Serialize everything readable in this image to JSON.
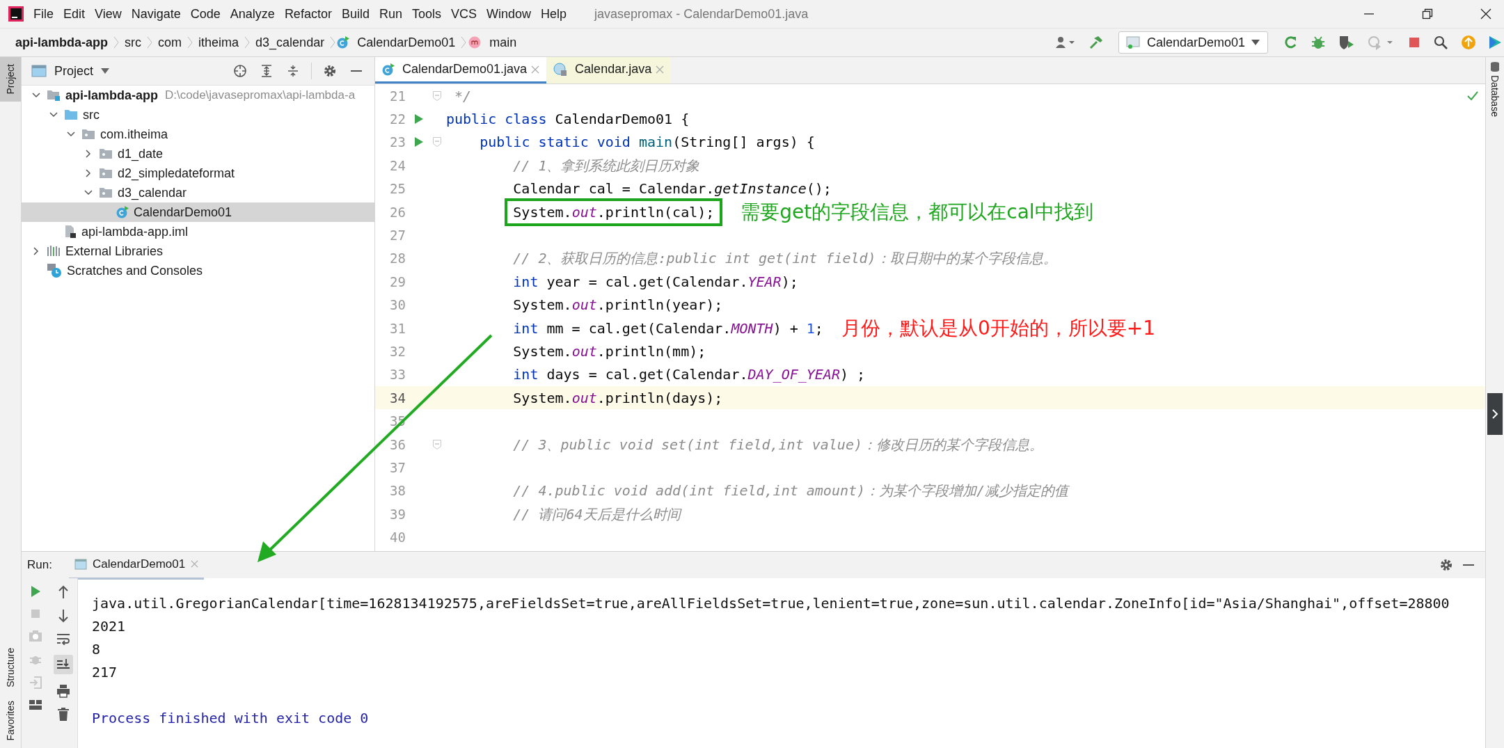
{
  "menu_bar": {
    "items": [
      "File",
      "Edit",
      "View",
      "Navigate",
      "Code",
      "Analyze",
      "Refactor",
      "Build",
      "Run",
      "Tools",
      "VCS",
      "Window",
      "Help"
    ],
    "window_title": "javasepromax - CalendarDemo01.java"
  },
  "breadcrumbs": [
    {
      "label": "api-lambda-app",
      "kind": "project"
    },
    {
      "label": "src",
      "kind": "folder"
    },
    {
      "label": "com",
      "kind": "folder"
    },
    {
      "label": "itheima",
      "kind": "folder"
    },
    {
      "label": "d3_calendar",
      "kind": "folder"
    },
    {
      "label": "CalendarDemo01",
      "kind": "class"
    },
    {
      "label": "main",
      "kind": "method"
    }
  ],
  "toolbar": {
    "run_config": "CalendarDemo01"
  },
  "side_strips": {
    "left_top": "Project",
    "left_bottom": [
      "Structure",
      "Favorites"
    ],
    "right": "Database"
  },
  "project_panel": {
    "title": "Project",
    "tree": [
      {
        "name": "api-lambda-app",
        "path": "D:\\code\\javasepromax\\api-lambda-a",
        "kind": "module",
        "expanded": true,
        "selected": false,
        "children": [
          {
            "name": "src",
            "kind": "source",
            "expanded": true,
            "selected": false,
            "children": [
              {
                "name": "com.itheima",
                "kind": "package",
                "expanded": true,
                "selected": false,
                "children": [
                  {
                    "name": "d1_date",
                    "kind": "package",
                    "expanded": false,
                    "selected": false
                  },
                  {
                    "name": "d2_simpledateformat",
                    "kind": "package",
                    "expanded": false,
                    "selected": false
                  },
                  {
                    "name": "d3_calendar",
                    "kind": "package",
                    "expanded": true,
                    "selected": false,
                    "children": [
                      {
                        "name": "CalendarDemo01",
                        "kind": "class",
                        "selected": true
                      }
                    ]
                  }
                ]
              }
            ]
          },
          {
            "name": "api-lambda-app.iml",
            "kind": "iml",
            "selected": false
          }
        ]
      },
      {
        "name": "External Libraries",
        "kind": "libraries",
        "expanded": false,
        "selected": false
      },
      {
        "name": "Scratches and Consoles",
        "kind": "scratches",
        "selected": false
      }
    ]
  },
  "editor": {
    "tabs": [
      {
        "title": "CalendarDemo01.java",
        "kind": "class",
        "selected": true
      },
      {
        "title": "Calendar.java",
        "kind": "library",
        "selected": false
      }
    ],
    "lines": [
      {
        "number": "21",
        "fold": true,
        "run_marker": false,
        "current": false,
        "boxed": false,
        "tokens": [
          {
            "text": " */",
            "kind": "comment"
          }
        ]
      },
      {
        "number": "22",
        "fold": false,
        "run_marker": true,
        "current": false,
        "boxed": false,
        "tokens": [
          {
            "text": "public class",
            "kind": "keyword"
          },
          {
            "text": " CalendarDemo01 {",
            "kind": "plain"
          }
        ]
      },
      {
        "number": "23",
        "fold": true,
        "run_marker": true,
        "current": false,
        "boxed": false,
        "tokens": [
          {
            "text": "    public static void ",
            "kind": "keyword"
          },
          {
            "text": "main",
            "kind": "declaration"
          },
          {
            "text": "(String[] args) {",
            "kind": "plain"
          }
        ]
      },
      {
        "number": "24",
        "fold": false,
        "run_marker": false,
        "current": false,
        "boxed": false,
        "tokens": [
          {
            "text": "        // 1、拿到系统此刻日历对象",
            "kind": "comment"
          }
        ]
      },
      {
        "number": "25",
        "fold": false,
        "run_marker": false,
        "current": false,
        "boxed": false,
        "tokens": [
          {
            "text": "        Calendar cal = Calendar.",
            "kind": "plain"
          },
          {
            "text": "getInstance",
            "kind": "static"
          },
          {
            "text": "();",
            "kind": "plain"
          }
        ]
      },
      {
        "number": "26",
        "fold": false,
        "run_marker": false,
        "current": false,
        "boxed": true,
        "note": {
          "text": "需要get的字段信息，都可以在cal中找到",
          "color": "#1fa61f"
        },
        "tokens": [
          {
            "text": "        System.",
            "kind": "plain"
          },
          {
            "text": "out",
            "kind": "field"
          },
          {
            "text": ".println(cal);",
            "kind": "plain"
          }
        ]
      },
      {
        "number": "27",
        "fold": false,
        "run_marker": false,
        "current": false
      },
      {
        "number": "28",
        "fold": false,
        "run_marker": false,
        "current": false,
        "boxed": false,
        "tokens": [
          {
            "text": "        // 2、获取日历的信息:public int get(int field)：取日期中的某个字段信息。",
            "kind": "comment"
          }
        ]
      },
      {
        "number": "29",
        "fold": false,
        "run_marker": false,
        "current": false,
        "boxed": false,
        "tokens": [
          {
            "text": "        int",
            "kind": "keyword"
          },
          {
            "text": " year = cal.get(Calendar.",
            "kind": "plain"
          },
          {
            "text": "YEAR",
            "kind": "field"
          },
          {
            "text": ");",
            "kind": "plain"
          }
        ]
      },
      {
        "number": "30",
        "fold": false,
        "run_marker": false,
        "current": false,
        "boxed": false,
        "tokens": [
          {
            "text": "        System.",
            "kind": "plain"
          },
          {
            "text": "out",
            "kind": "field"
          },
          {
            "text": ".println(year);",
            "kind": "plain"
          }
        ]
      },
      {
        "number": "31",
        "fold": false,
        "run_marker": false,
        "current": false,
        "boxed": false,
        "note": {
          "text": "月份，默认是从0开始的，所以要+1",
          "color": "#ff1a1a"
        },
        "tokens": [
          {
            "text": "        int",
            "kind": "keyword"
          },
          {
            "text": " mm = cal.get(Calendar.",
            "kind": "plain"
          },
          {
            "text": "MONTH",
            "kind": "field"
          },
          {
            "text": ") + ",
            "kind": "plain"
          },
          {
            "text": "1",
            "kind": "number"
          },
          {
            "text": ";",
            "kind": "plain"
          }
        ]
      },
      {
        "number": "32",
        "fold": false,
        "run_marker": false,
        "current": false,
        "boxed": false,
        "tokens": [
          {
            "text": "        System.",
            "kind": "plain"
          },
          {
            "text": "out",
            "kind": "field"
          },
          {
            "text": ".println(mm);",
            "kind": "plain"
          }
        ]
      },
      {
        "number": "33",
        "fold": false,
        "run_marker": false,
        "current": false,
        "boxed": false,
        "tokens": [
          {
            "text": "        int",
            "kind": "keyword"
          },
          {
            "text": " days = cal.get(Calendar.",
            "kind": "plain"
          },
          {
            "text": "DAY_OF_YEAR",
            "kind": "field"
          },
          {
            "text": ") ;",
            "kind": "plain"
          }
        ]
      },
      {
        "number": "34",
        "fold": false,
        "run_marker": false,
        "current": true,
        "boxed": false,
        "tokens": [
          {
            "text": "        System.",
            "kind": "plain"
          },
          {
            "text": "out",
            "kind": "field"
          },
          {
            "text": ".println(days);",
            "kind": "plain"
          }
        ]
      },
      {
        "number": "35",
        "fold": false,
        "run_marker": false,
        "current": false
      },
      {
        "number": "36",
        "fold": true,
        "run_marker": false,
        "current": false,
        "boxed": false,
        "tokens": [
          {
            "text": "        // 3、public void set(int field,int value)：修改日历的某个字段信息。",
            "kind": "comment"
          }
        ]
      },
      {
        "number": "37",
        "fold": false,
        "run_marker": false,
        "current": false
      },
      {
        "number": "38",
        "fold": false,
        "run_marker": false,
        "current": false,
        "boxed": false,
        "tokens": [
          {
            "text": "        // 4.public void add(int field,int amount)：为某个字段增加/减少指定的值",
            "kind": "comment"
          }
        ]
      },
      {
        "number": "39",
        "fold": false,
        "run_marker": false,
        "current": false,
        "boxed": false,
        "tokens": [
          {
            "text": "        // 请问64天后是什么时间",
            "kind": "comment"
          }
        ]
      },
      {
        "number": "40",
        "fold": false,
        "run_marker": false,
        "current": false
      }
    ]
  },
  "run_panel": {
    "label": "Run:",
    "tab": "CalendarDemo01",
    "output": [
      {
        "text": "java.util.GregorianCalendar[time=1628134192575,areFieldsSet=true,areAllFieldsSet=true,lenient=true,zone=sun.util.calendar.ZoneInfo[id=\"Asia/Shanghai\",offset=28800",
        "kind": "stdout"
      },
      {
        "text": "2021",
        "kind": "stdout"
      },
      {
        "text": "8",
        "kind": "stdout"
      },
      {
        "text": "217",
        "kind": "stdout"
      },
      {
        "text": "Process finished with exit code 0",
        "kind": "exit"
      }
    ]
  }
}
